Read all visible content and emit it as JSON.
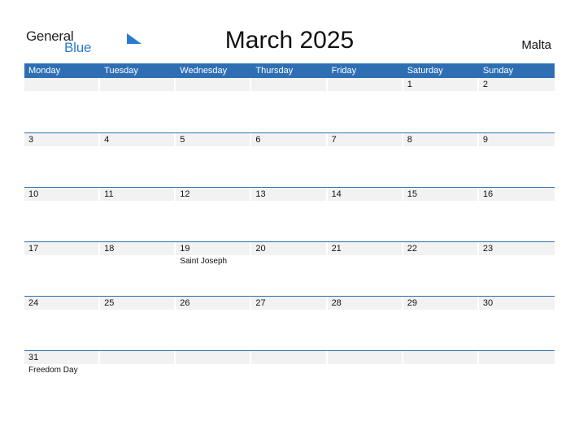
{
  "logo": {
    "line1": "General",
    "line2": "Blue",
    "accent_color": "#2a7bd0"
  },
  "title": "March 2025",
  "country": "Malta",
  "header_color": "#2e6fb4",
  "weekdays": [
    "Monday",
    "Tuesday",
    "Wednesday",
    "Thursday",
    "Friday",
    "Saturday",
    "Sunday"
  ],
  "weeks": [
    {
      "days": [
        {
          "num": "",
          "holiday": ""
        },
        {
          "num": "",
          "holiday": ""
        },
        {
          "num": "",
          "holiday": ""
        },
        {
          "num": "",
          "holiday": ""
        },
        {
          "num": "",
          "holiday": ""
        },
        {
          "num": "1",
          "holiday": ""
        },
        {
          "num": "2",
          "holiday": ""
        }
      ]
    },
    {
      "days": [
        {
          "num": "3",
          "holiday": ""
        },
        {
          "num": "4",
          "holiday": ""
        },
        {
          "num": "5",
          "holiday": ""
        },
        {
          "num": "6",
          "holiday": ""
        },
        {
          "num": "7",
          "holiday": ""
        },
        {
          "num": "8",
          "holiday": ""
        },
        {
          "num": "9",
          "holiday": ""
        }
      ]
    },
    {
      "days": [
        {
          "num": "10",
          "holiday": ""
        },
        {
          "num": "11",
          "holiday": ""
        },
        {
          "num": "12",
          "holiday": ""
        },
        {
          "num": "13",
          "holiday": ""
        },
        {
          "num": "14",
          "holiday": ""
        },
        {
          "num": "15",
          "holiday": ""
        },
        {
          "num": "16",
          "holiday": ""
        }
      ]
    },
    {
      "days": [
        {
          "num": "17",
          "holiday": ""
        },
        {
          "num": "18",
          "holiday": ""
        },
        {
          "num": "19",
          "holiday": "Saint Joseph"
        },
        {
          "num": "20",
          "holiday": ""
        },
        {
          "num": "21",
          "holiday": ""
        },
        {
          "num": "22",
          "holiday": ""
        },
        {
          "num": "23",
          "holiday": ""
        }
      ]
    },
    {
      "days": [
        {
          "num": "24",
          "holiday": ""
        },
        {
          "num": "25",
          "holiday": ""
        },
        {
          "num": "26",
          "holiday": ""
        },
        {
          "num": "27",
          "holiday": ""
        },
        {
          "num": "28",
          "holiday": ""
        },
        {
          "num": "29",
          "holiday": ""
        },
        {
          "num": "30",
          "holiday": ""
        }
      ]
    },
    {
      "days": [
        {
          "num": "31",
          "holiday": "Freedom Day"
        },
        {
          "num": "",
          "holiday": ""
        },
        {
          "num": "",
          "holiday": ""
        },
        {
          "num": "",
          "holiday": ""
        },
        {
          "num": "",
          "holiday": ""
        },
        {
          "num": "",
          "holiday": ""
        },
        {
          "num": "",
          "holiday": ""
        }
      ]
    }
  ]
}
